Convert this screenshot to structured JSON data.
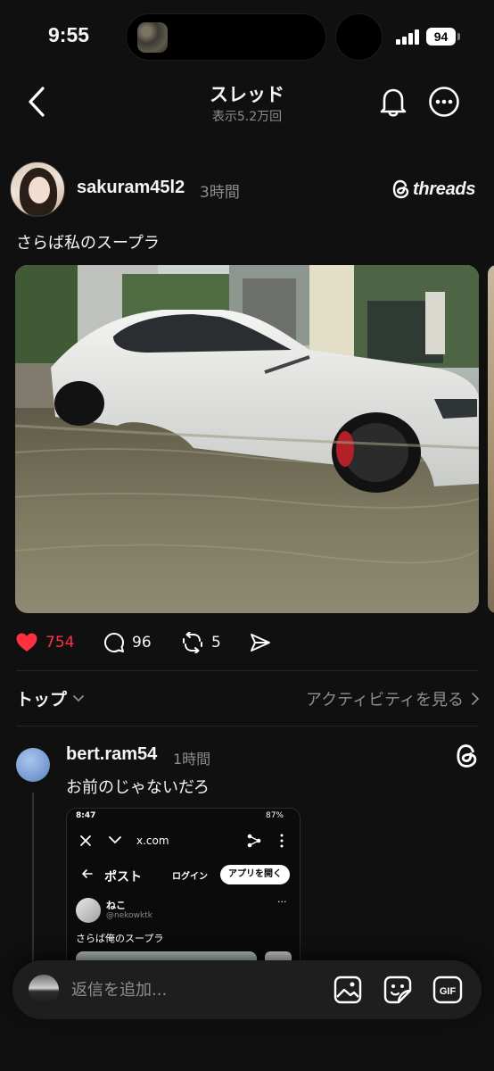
{
  "status_bar": {
    "time": "9:55",
    "battery": "94"
  },
  "header": {
    "title": "スレッド",
    "subtitle": "表示5.2万回"
  },
  "post": {
    "author": "sakuram45l2",
    "time": "3時間",
    "brand": "threads",
    "text": "さらば私のスープラ",
    "likes": "754",
    "comments": "96",
    "reposts": "5"
  },
  "sort": {
    "label": "トップ",
    "activity_link": "アクティビティを見る"
  },
  "reply": {
    "author": "bert.ram54",
    "time": "1時間",
    "text": "お前のじゃないだろ",
    "embed": {
      "status_time": "8:47",
      "status_right": "87%",
      "url": "x.com",
      "post_label": "ポスト",
      "login": "ログイン",
      "open_app": "アプリを開く",
      "name": "ねこ",
      "handle": "@nekowktk",
      "text": "さらば俺のスープラ"
    }
  },
  "compose": {
    "placeholder": "返信を追加..."
  },
  "colors": {
    "background": "#101010",
    "like": "#ff3040",
    "secondary_text": "#8e8e8e"
  }
}
